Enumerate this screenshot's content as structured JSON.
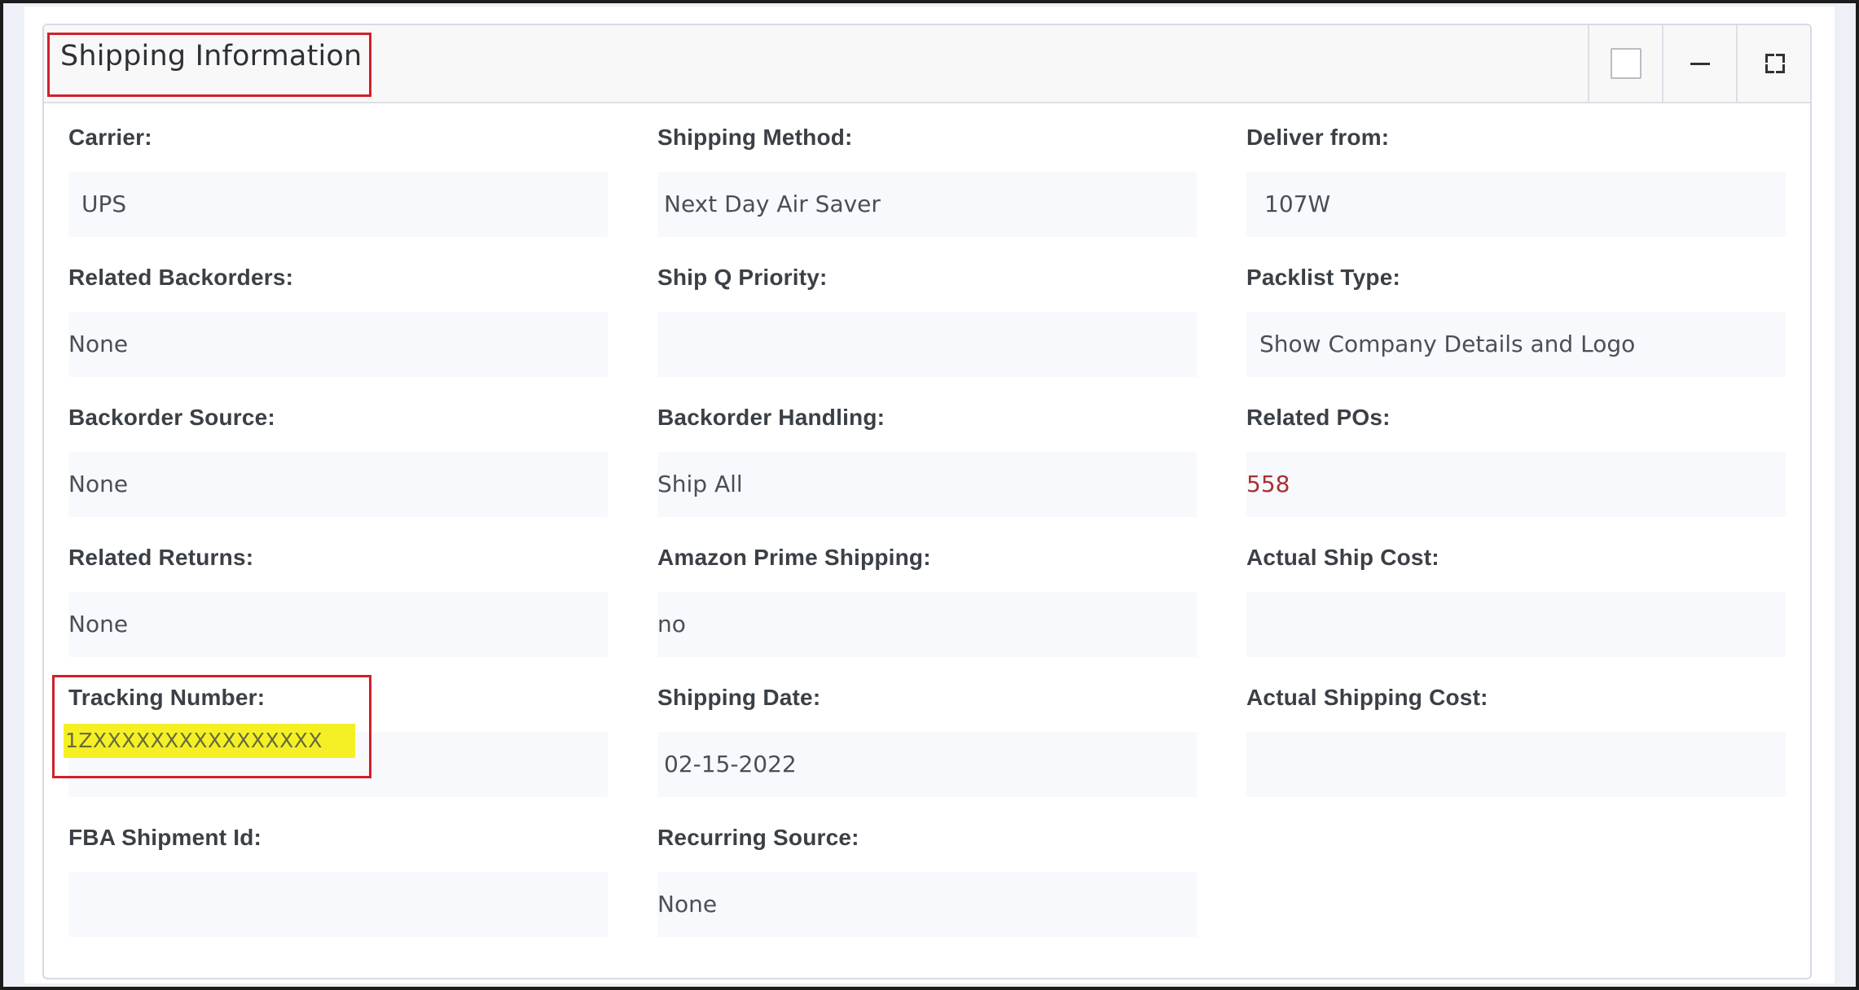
{
  "panel": {
    "title": "Shipping Information"
  },
  "header_buttons": [
    {
      "icon": "checkbox-icon"
    },
    {
      "icon": "minus-icon"
    },
    {
      "icon": "expand-icon"
    }
  ],
  "fields": {
    "carrier": {
      "label": "Carrier:",
      "value": "UPS"
    },
    "shipping_method": {
      "label": "Shipping Method:",
      "value": "Next Day Air Saver"
    },
    "deliver_from": {
      "label": "Deliver from:",
      "value": "107W"
    },
    "related_backorders": {
      "label": "Related Backorders:",
      "value": "None"
    },
    "ship_q_priority": {
      "label": "Ship Q Priority:",
      "value": ""
    },
    "packlist_type": {
      "label": "Packlist Type:",
      "value": "Show Company Details and Logo"
    },
    "backorder_source": {
      "label": "Backorder Source:",
      "value": "None"
    },
    "backorder_handling": {
      "label": "Backorder Handling:",
      "value": "Ship All"
    },
    "related_pos": {
      "label": "Related POs:",
      "value": "558"
    },
    "related_returns": {
      "label": "Related Returns:",
      "value": "None"
    },
    "amazon_prime_shipping": {
      "label": "Amazon Prime Shipping:",
      "value": "no"
    },
    "actual_ship_cost": {
      "label": "Actual Ship Cost:",
      "value": ""
    },
    "tracking_number": {
      "label": "Tracking Number:",
      "value": "1ZXXXXXXXXXXXXXXXX"
    },
    "shipping_date": {
      "label": "Shipping Date:",
      "value": "02-15-2022"
    },
    "actual_shipping_cost": {
      "label": "Actual Shipping Cost:",
      "value": ""
    },
    "fba_shipment_id": {
      "label": "FBA Shipment Id:",
      "value": ""
    },
    "recurring_source": {
      "label": "Recurring Source:",
      "value": "None"
    }
  },
  "colors": {
    "link": "#a83232",
    "annotation": "#d0202a",
    "highlight": "#f4f025",
    "field_bg": "#f8f9fd"
  }
}
